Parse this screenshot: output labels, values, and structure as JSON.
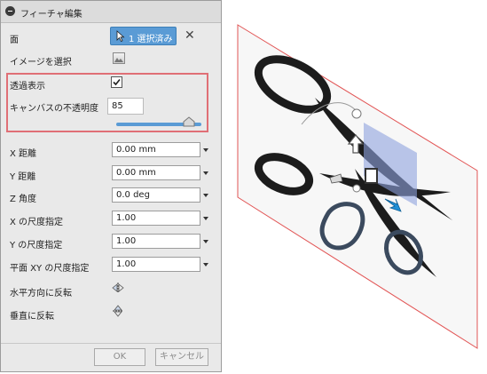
{
  "panel": {
    "title": "フィーチャ編集",
    "face_label": "面",
    "selection_button": "1 選択済み",
    "select_image_label": "イメージを選択",
    "transparency_label": "透過表示",
    "transparency_checked": true,
    "canvas_opacity_label": "キャンバスの不透明度",
    "canvas_opacity_value": "85",
    "opacity_fraction": 0.85,
    "fields": [
      {
        "label": "X 距離",
        "value": "0.00 mm"
      },
      {
        "label": "Y 距離",
        "value": "0.00 mm"
      },
      {
        "label": "Z 角度",
        "value": "0.0 deg"
      },
      {
        "label": "X の尺度指定",
        "value": "1.00"
      },
      {
        "label": "Y の尺度指定",
        "value": "1.00"
      },
      {
        "label": "平面 XY の尺度指定",
        "value": "1.00"
      }
    ],
    "flip_horizontal_label": "水平方向に反転",
    "flip_vertical_label": "垂直に反転",
    "ok_label": "OK",
    "cancel_label": "キャンセル"
  },
  "colors": {
    "accent": "#5a9bd5",
    "highlight": "#e06f76",
    "plane_border": "#e25555",
    "selection_fill": "#8ea2dd",
    "arrow_blue": "#1f8fd6"
  },
  "icons": {
    "collapse": "minus-circle-icon",
    "cursor": "pointer-cursor-icon",
    "clear": "close-icon",
    "image": "image-icon",
    "flip_h": "flip-horizontal-icon",
    "flip_v": "flip-vertical-icon"
  }
}
